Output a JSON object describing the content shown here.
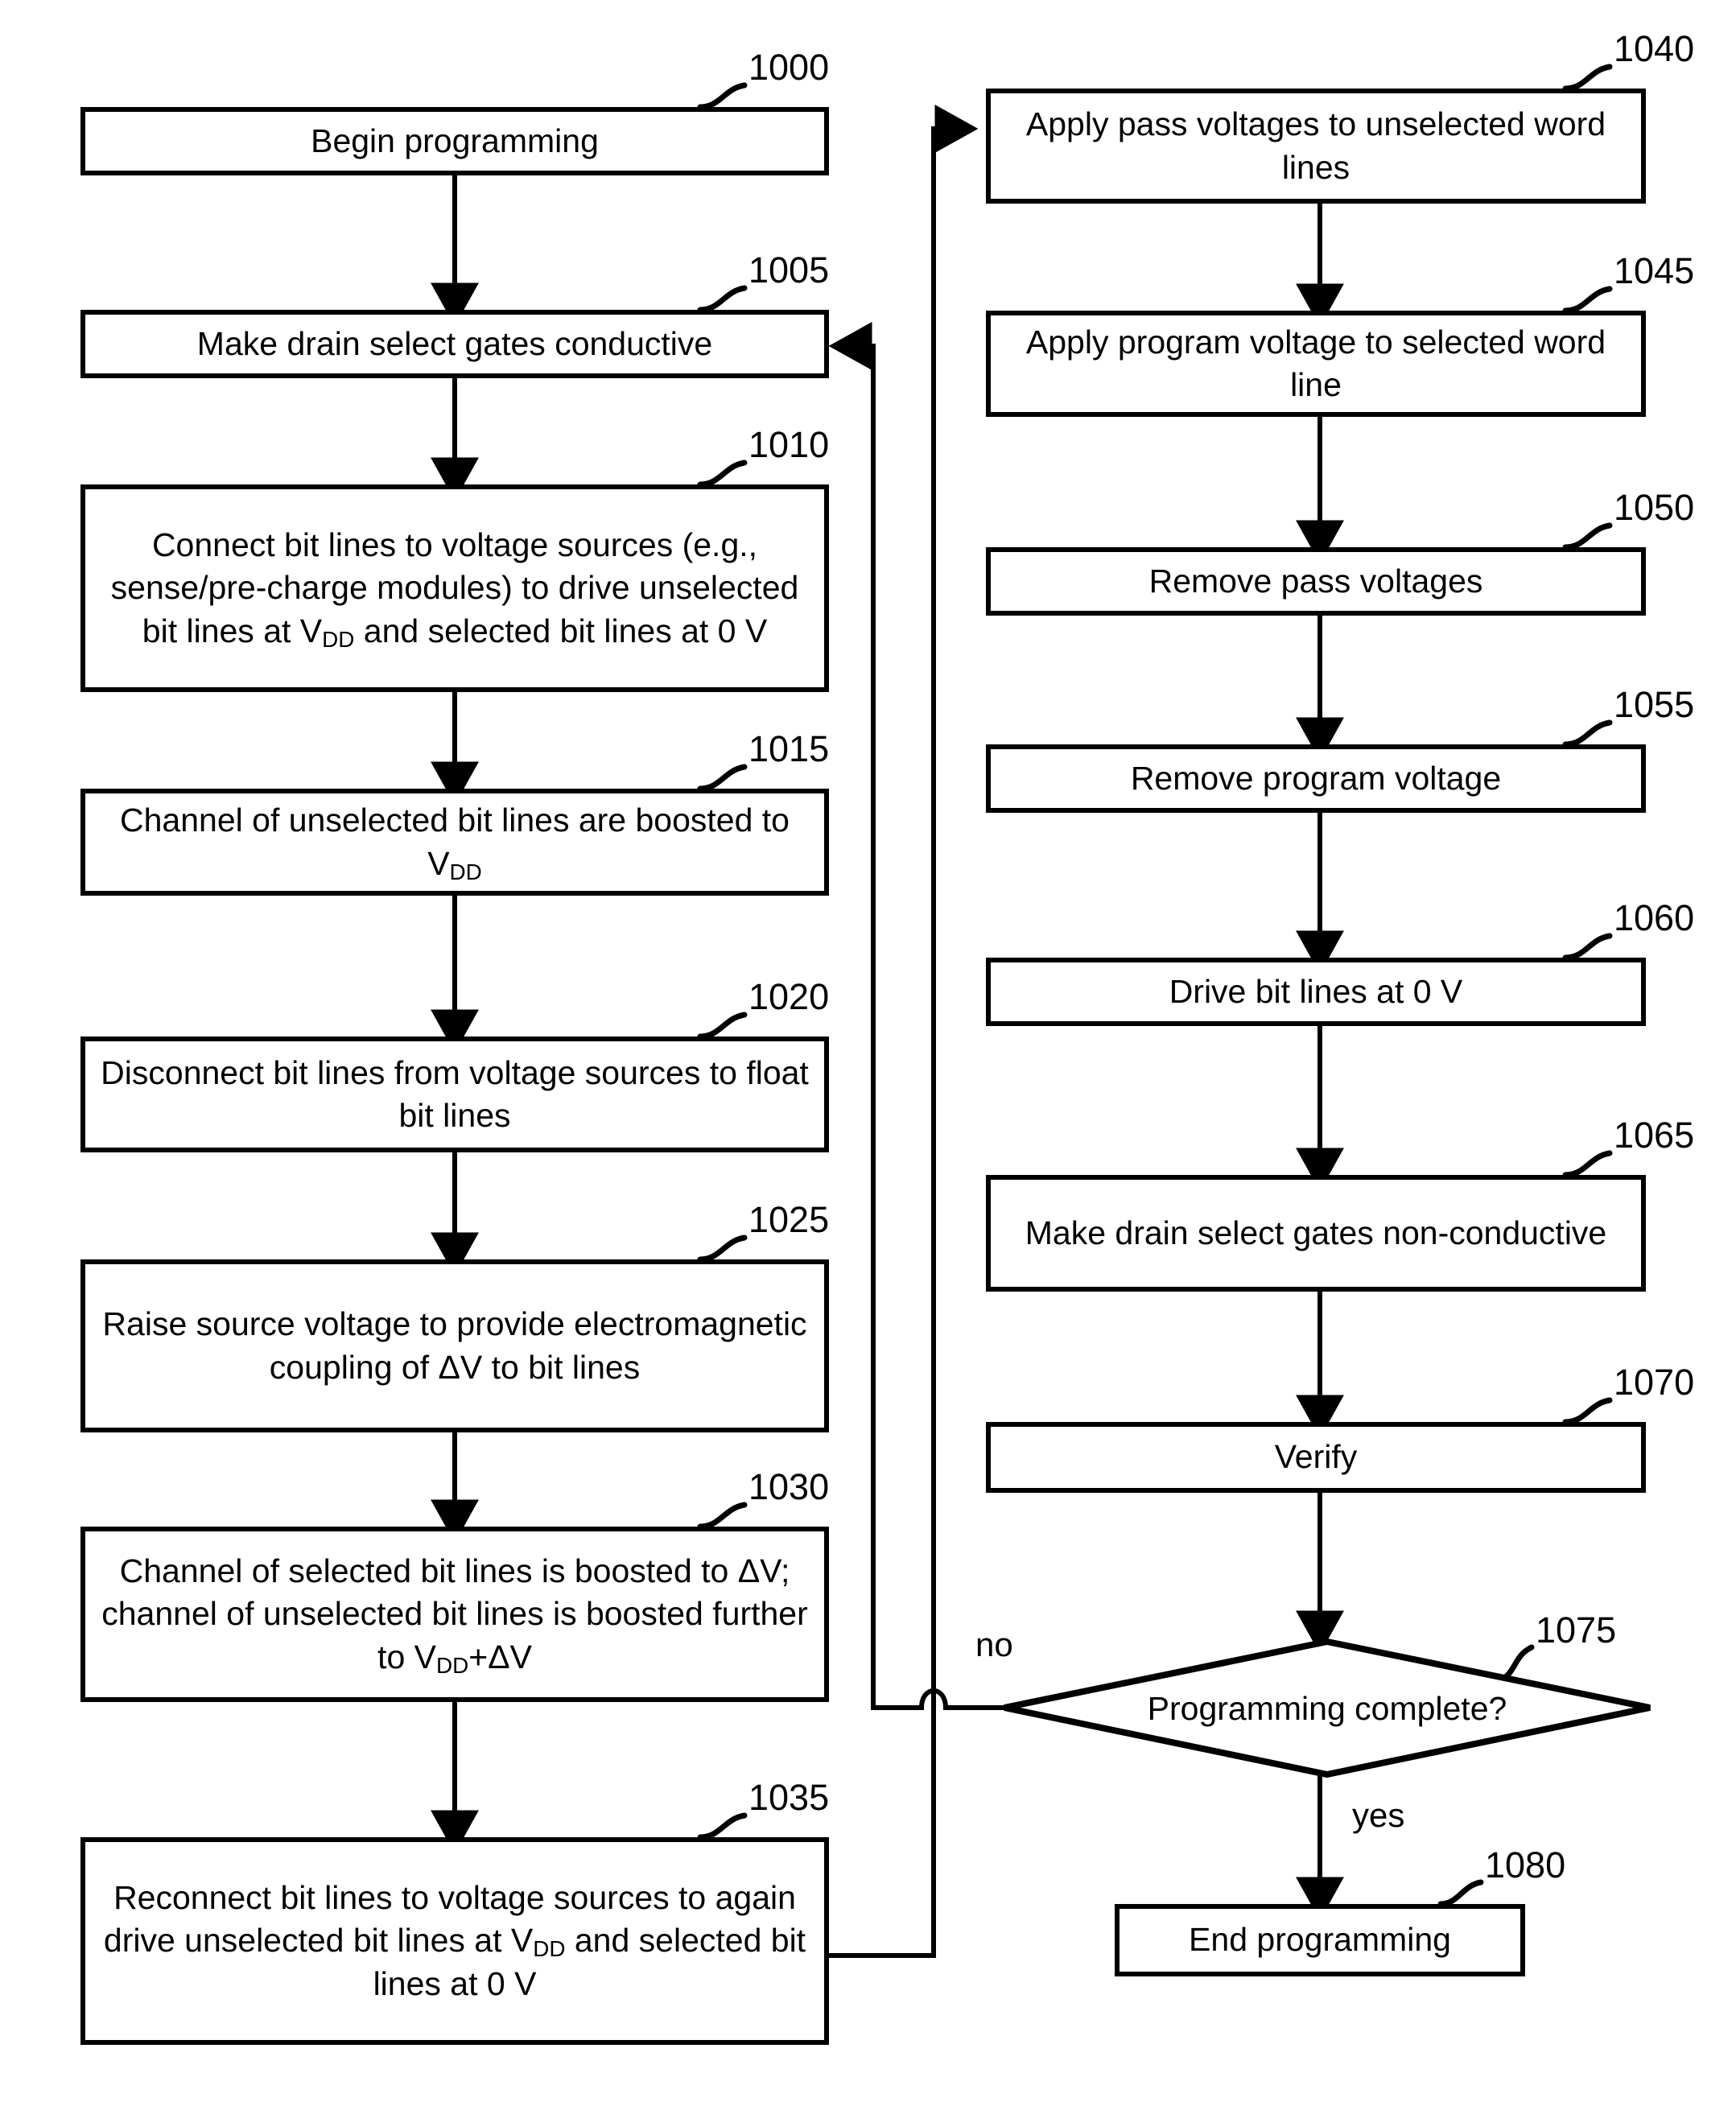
{
  "figure": {
    "type": "flowchart",
    "orientation": "two-column",
    "nodes": [
      {
        "ref": "1000",
        "shape": "rect",
        "text": "Begin programming"
      },
      {
        "ref": "1005",
        "shape": "rect",
        "text": "Make drain select gates conductive"
      },
      {
        "ref": "1010",
        "shape": "rect",
        "text": "Connect bit lines to voltage sources (e.g., sense/pre-charge modules) to drive unselected bit lines at V<sub>DD</sub> and selected bit lines at 0 V"
      },
      {
        "ref": "1015",
        "shape": "rect",
        "text": "Channel of unselected bit lines are boosted to V<sub>DD</sub>"
      },
      {
        "ref": "1020",
        "shape": "rect",
        "text": "Disconnect bit lines from voltage sources to float bit lines"
      },
      {
        "ref": "1025",
        "shape": "rect",
        "text": "Raise source voltage to provide electromagnetic coupling of ΔV to bit lines"
      },
      {
        "ref": "1030",
        "shape": "rect",
        "text": "Channel of selected bit lines is boosted to ΔV; channel of unselected bit lines is boosted further to V<sub>DD</sub>+ΔV"
      },
      {
        "ref": "1035",
        "shape": "rect",
        "text": "Reconnect bit lines to voltage sources to again drive unselected bit lines at V<sub>DD</sub> and selected bit lines at 0 V"
      },
      {
        "ref": "1040",
        "shape": "rect",
        "text": "Apply pass voltages to unselected word lines"
      },
      {
        "ref": "1045",
        "shape": "rect",
        "text": "Apply program voltage to selected word line"
      },
      {
        "ref": "1050",
        "shape": "rect",
        "text": "Remove pass voltages"
      },
      {
        "ref": "1055",
        "shape": "rect",
        "text": "Remove program voltage"
      },
      {
        "ref": "1060",
        "shape": "rect",
        "text": "Drive bit lines at 0 V"
      },
      {
        "ref": "1065",
        "shape": "rect",
        "text": "Make drain select gates non-conductive"
      },
      {
        "ref": "1070",
        "shape": "rect",
        "text": "Verify"
      },
      {
        "ref": "1075",
        "shape": "diamond",
        "text": "Programming complete?"
      },
      {
        "ref": "1080",
        "shape": "rect",
        "text": "End programming"
      }
    ],
    "edge_labels": {
      "no": "no",
      "yes": "yes"
    },
    "colors": {
      "stroke": "#000000",
      "fill": "#ffffff",
      "text": "#000000"
    }
  }
}
